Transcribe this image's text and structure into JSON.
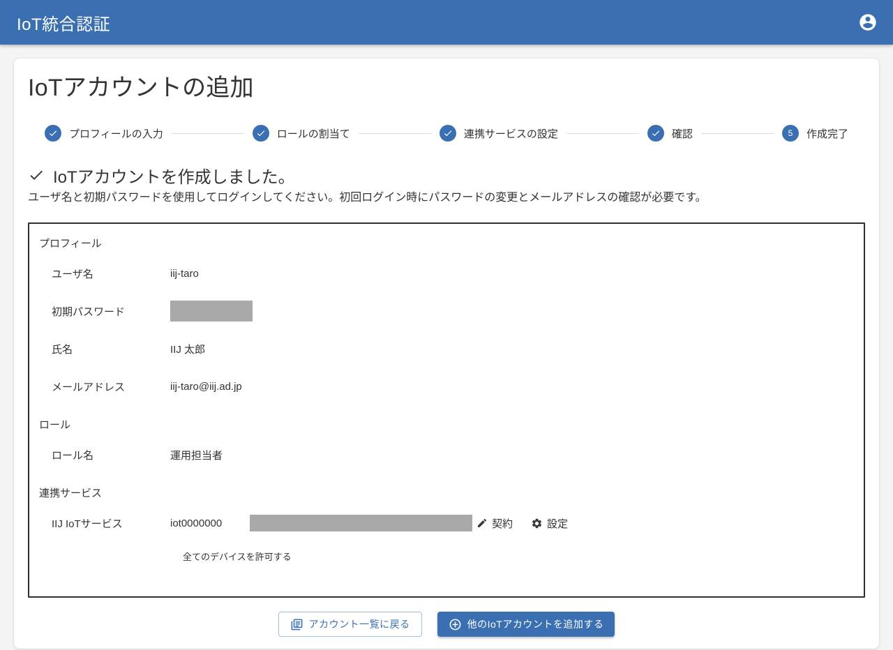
{
  "header": {
    "title": "IoT統合認証"
  },
  "page": {
    "title": "IoTアカウントの追加"
  },
  "stepper": {
    "steps": [
      {
        "label": "プロフィールの入力",
        "state": "complete"
      },
      {
        "label": "ロールの割当て",
        "state": "complete"
      },
      {
        "label": "連携サービスの設定",
        "state": "complete"
      },
      {
        "label": "確認",
        "state": "complete"
      },
      {
        "label": "作成完了",
        "state": "current",
        "number": "5"
      }
    ]
  },
  "result": {
    "heading": "IoTアカウントを作成しました。",
    "note": "ユーザ名と初期パスワードを使用してログインしてください。初回ログイン時にパスワードの変更とメールアドレスの確認が必要です。"
  },
  "details": {
    "profile": {
      "title": "プロフィール",
      "username_label": "ユーザ名",
      "username_value": "iij-taro",
      "password_label": "初期パスワード",
      "password_value_masked": "redacted",
      "fullname_label": "氏名",
      "fullname_value": "IIJ 太郎",
      "email_label": "メールアドレス",
      "email_value": "iij-taro@iij.ad.jp"
    },
    "role": {
      "title": "ロール",
      "name_label": "ロール名",
      "name_value": "運用担当者"
    },
    "services": {
      "title": "連携サービス",
      "service_label": "IIJ IoTサービス",
      "service_value": "iot0000000",
      "contract_value_masked": "redacted",
      "contract_label": "契約",
      "settings_label": "設定",
      "note": "全てのデバイスを許可する"
    }
  },
  "actions": {
    "back_label": "アカウント一覧に戻る",
    "add_label": "他のIoTアカウントを追加する"
  },
  "icons": {
    "header_account": "account-circle",
    "step_complete": "check",
    "result": "check",
    "contract": "pencil",
    "settings": "gear",
    "back_button": "list-pages",
    "add_button": "plus-circle"
  },
  "colors": {
    "primary": "#3a70b2",
    "redacted": "#a9a9a9",
    "background": "#f4f4f4"
  }
}
